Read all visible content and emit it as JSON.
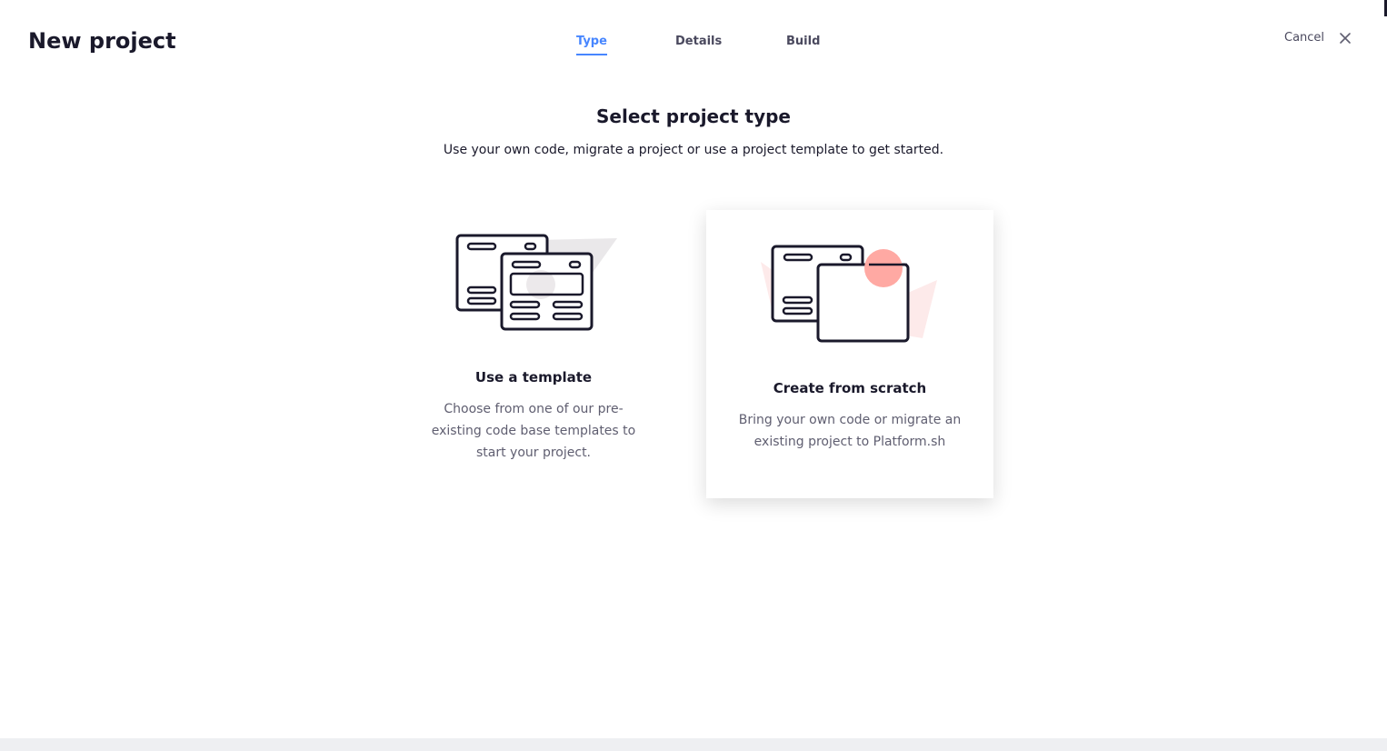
{
  "header": {
    "title": "New project",
    "cancel_label": "Cancel",
    "close_icon": "close-icon"
  },
  "steps": [
    {
      "label": "Type",
      "active": true
    },
    {
      "label": "Details",
      "active": false
    },
    {
      "label": "Build",
      "active": false
    }
  ],
  "main": {
    "title": "Select project type",
    "description": "Use your own code, migrate a project or use a project template to get started."
  },
  "options": [
    {
      "title": "Use a template",
      "description": "Choose from one of our pre-existing code base templates to start your project.",
      "icon": "template-illustration"
    },
    {
      "title": "Create from scratch",
      "description": "Bring your own code or migrate an existing project to Platform.sh",
      "icon": "scratch-illustration",
      "hovered": true
    }
  ],
  "colors": {
    "accent": "#4786ff",
    "text": "#1a192b",
    "muted": "#5f5e70",
    "illustration_accent": "#ffa9a3"
  }
}
